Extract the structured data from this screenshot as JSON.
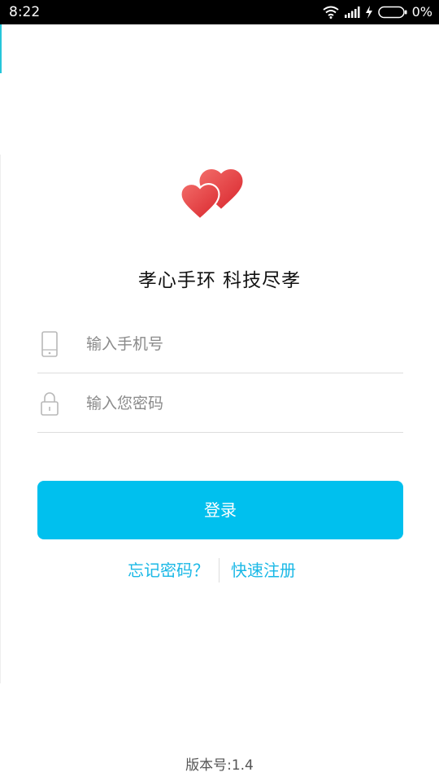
{
  "status_bar": {
    "time": "8:22",
    "battery_percent": "0%",
    "icons": [
      "wifi-icon",
      "signal-icon",
      "charging-icon",
      "battery-icon"
    ]
  },
  "app": {
    "title": "孝心手环 科技尽孝",
    "logo_icon": "hearts-logo-icon",
    "logo_color": "#e8403e"
  },
  "form": {
    "phone": {
      "icon": "phone-icon",
      "placeholder": "输入手机号",
      "value": ""
    },
    "password": {
      "icon": "lock-icon",
      "placeholder": "输入您密码",
      "value": ""
    }
  },
  "login_button": {
    "label": "登录",
    "color": "#00c0ee"
  },
  "links": {
    "forgot": "忘记密码？",
    "register": "快速注册",
    "color": "#1ab8e6"
  },
  "version": "版本号:1.4"
}
